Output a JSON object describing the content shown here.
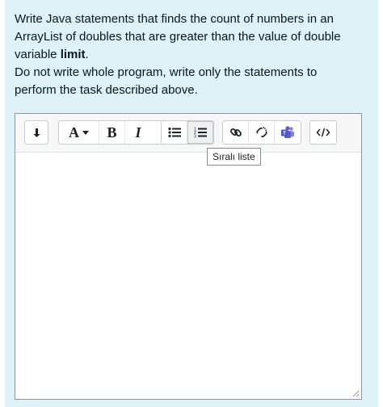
{
  "question": {
    "line1": "Write Java statements that finds the count of numbers in an",
    "line2": "ArrayList of doubles that are greater than the value of double",
    "line3_prefix": "variable ",
    "line3_bold": "limit",
    "line3_suffix": ".",
    "line4": "Do not write whole program, write only the statements to",
    "line5": "perform the task described above."
  },
  "toolbar": {
    "buttons": [
      "collapse-toolbar",
      "font-color",
      "bold",
      "italic",
      "unordered-list",
      "ordered-list",
      "link",
      "unlink",
      "teams-meeting",
      "html-source"
    ],
    "bold_label": "B",
    "italic_label": "I",
    "font_color_label": "A"
  },
  "tooltip": {
    "text": "Sıralı liste"
  },
  "editor": {
    "content": ""
  },
  "colors": {
    "panel_bg": "#def2f8",
    "teams_purple": "#5b5fc7",
    "text": "#001a1e"
  }
}
